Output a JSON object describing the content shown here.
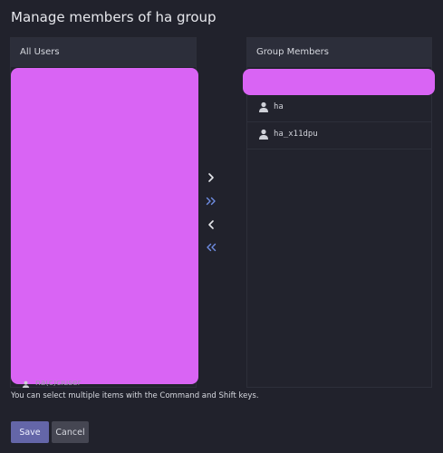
{
  "dialog": {
    "title": "Manage members of ha group"
  },
  "all_users": {
    "header": "All Users",
    "partial_visible_item": "ha(c)ciuser"
  },
  "group_members": {
    "header": "Group Members",
    "items": [
      {
        "label": "ha",
        "icon": "user-icon"
      },
      {
        "label": "ha_x11dpu",
        "icon": "user-icon"
      }
    ]
  },
  "transfer_controls": {
    "add_selected": {
      "icon": "chevron-right-icon",
      "color": "#e6e7ec"
    },
    "add_all": {
      "icon": "double-chevron-right-icon",
      "color": "#6f8de3"
    },
    "remove_selected": {
      "icon": "chevron-left-icon",
      "color": "#e6e7ec"
    },
    "remove_all": {
      "icon": "double-chevron-left-icon",
      "color": "#6f8de3"
    }
  },
  "help_text": "You can select multiple items with the Command and Shift keys.",
  "buttons": {
    "save": "Save",
    "cancel": "Cancel"
  },
  "colors": {
    "background": "#21222c",
    "redaction": "#d964f4",
    "primary_button": "#6466a8"
  }
}
